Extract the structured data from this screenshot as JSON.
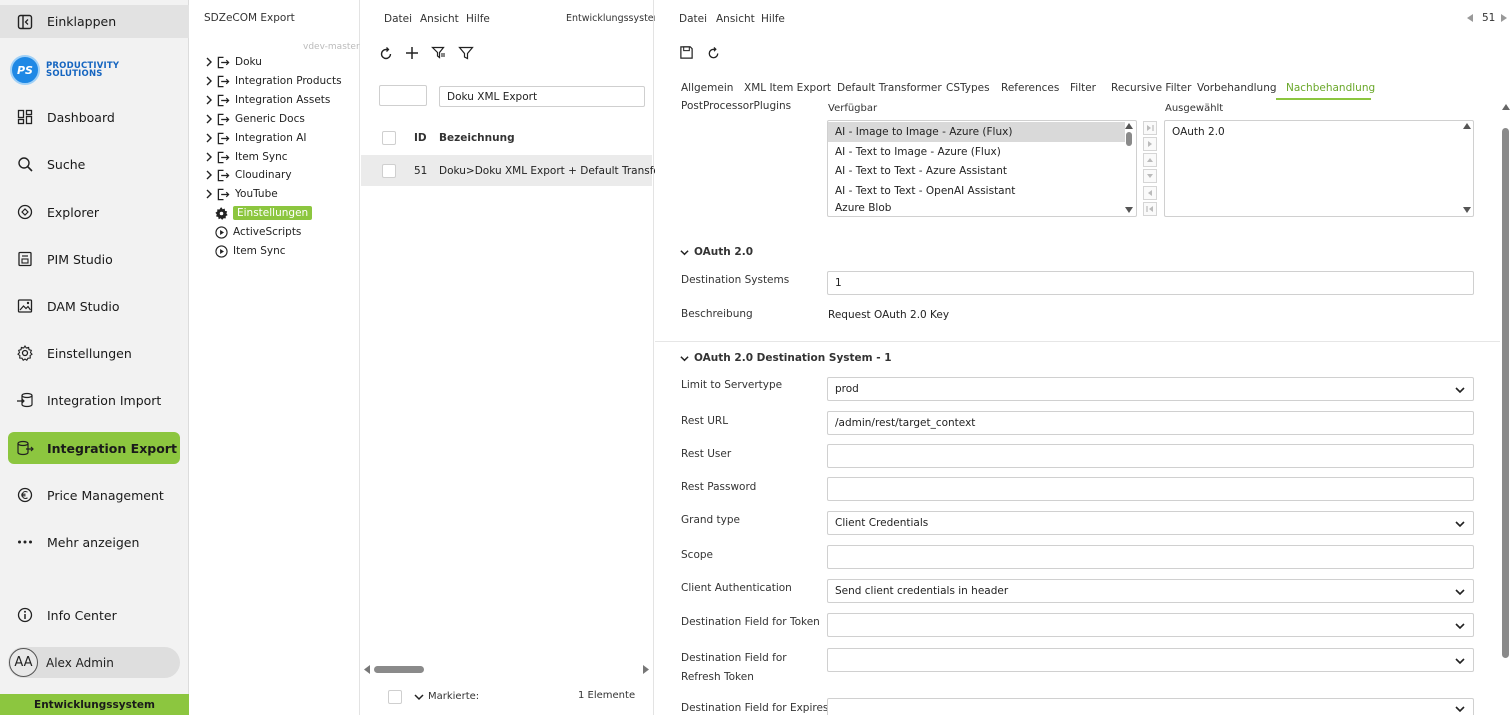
{
  "sidebar": {
    "collapse": "Einklappen",
    "logo": {
      "initials": "PS",
      "line1": "PRODUCTIVITY",
      "line2": "SOLUTIONS"
    },
    "items": [
      {
        "label": "Dashboard"
      },
      {
        "label": "Suche"
      },
      {
        "label": "Explorer"
      },
      {
        "label": "PIM Studio"
      },
      {
        "label": "DAM Studio"
      },
      {
        "label": "Einstellungen"
      },
      {
        "label": "Integration Import"
      },
      {
        "label": "Integration Export"
      },
      {
        "label": "Price Management"
      },
      {
        "label": "Mehr anzeigen"
      },
      {
        "label": "Info Center"
      }
    ],
    "user": {
      "initials": "AA",
      "name": "Alex Admin"
    },
    "environment": "Entwicklungssystem",
    "accent": "#8cc63f"
  },
  "tree": {
    "title": "SDZeCOM Export",
    "branch": "vdev-master",
    "folders": [
      "Doku",
      "Integration Products",
      "Integration Assets",
      "Generic Docs",
      "Integration AI",
      "Item Sync",
      "Cloudinary",
      "YouTube"
    ],
    "leaves": [
      "Einstellungen",
      "ActiveScripts",
      "Item Sync"
    ]
  },
  "list": {
    "menu": [
      "Datei",
      "Ansicht",
      "Hilfe"
    ],
    "environment": "Entwicklungssystem",
    "search_value": "Doku XML Export",
    "columns": {
      "id": "ID",
      "name": "Bezeichnung"
    },
    "rows": [
      {
        "id": "51",
        "name": "Doku>Doku XML Export + Default Transformer"
      }
    ],
    "footer": {
      "label": "Markierte:",
      "count": "1 Elemente"
    }
  },
  "detail": {
    "menu": [
      "Datei",
      "Ansicht",
      "Hilfe"
    ],
    "record_number": "51",
    "tabs": [
      "Allgemein",
      "XML Item Export",
      "Default Transformer",
      "CSTypes",
      "References",
      "Filter",
      "Recursive Filter",
      "Vorbehandlung",
      "Nachbehandlung"
    ],
    "plugins": {
      "label": "PostProcessorPlugins",
      "available_label": "Verfügbar",
      "selected_label": "Ausgewählt",
      "available": [
        "AI - Image to Image - Azure (Flux)",
        "AI - Text to Image - Azure (Flux)",
        "AI - Text to Text - Azure Assistant",
        "AI - Text to Text - OpenAI Assistant",
        "Azure Blob"
      ],
      "selected": [
        "OAuth 2.0"
      ]
    },
    "oauth": {
      "title": "OAuth 2.0",
      "dest_systems_label": "Destination Systems",
      "dest_systems_value": "1",
      "desc_label": "Beschreibung",
      "desc_value": "Request OAuth 2.0 Key"
    },
    "dest": {
      "title": "OAuth 2.0 Destination System - 1",
      "fields": {
        "servertype": {
          "label": "Limit to Servertype",
          "value": "prod"
        },
        "rest_url": {
          "label": "Rest URL",
          "value": "/admin/rest/target_context"
        },
        "rest_user": {
          "label": "Rest User",
          "value": ""
        },
        "rest_password": {
          "label": "Rest Password",
          "value": ""
        },
        "grand_type": {
          "label": "Grand type",
          "value": "Client Credentials"
        },
        "scope": {
          "label": "Scope",
          "value": ""
        },
        "client_auth": {
          "label": "Client Authentication",
          "value": "Send client credentials in header"
        },
        "token_field": {
          "label": "Destination Field for Token",
          "value": ""
        },
        "refresh_field": {
          "label": "Destination Field for Refresh Token",
          "value": ""
        },
        "expires_field": {
          "label": "Destination Field for Expires",
          "value": ""
        }
      }
    }
  }
}
